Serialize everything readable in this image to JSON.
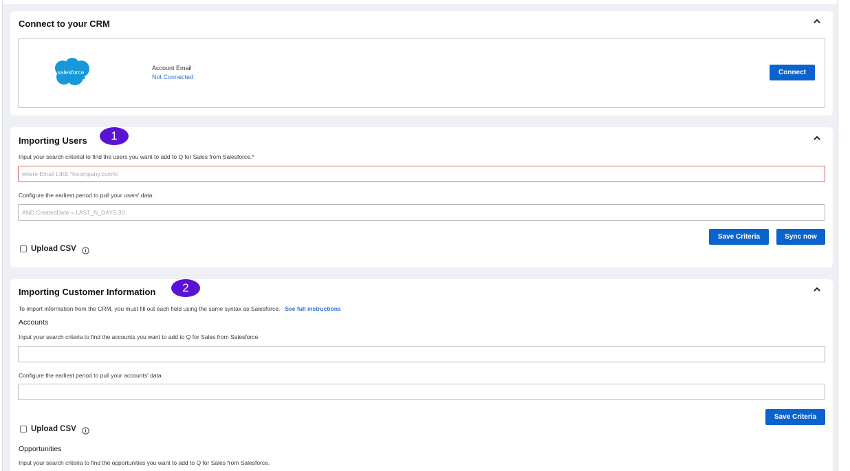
{
  "crm": {
    "title": "Connect to your CRM",
    "logo_text": "salesforce",
    "account_label": "Account Email",
    "account_status": "Not Connected",
    "connect_label": "Connect"
  },
  "users": {
    "title": "Importing Users",
    "badge": "1",
    "search_hint": "Input your search criterial to find the users you want to add to Q for Sales from Salesforce.*",
    "search_placeholder": "where Email LIKE '%company.com%'",
    "period_hint": "Configure the earliest period to pull your users' data.",
    "period_placeholder": "AND CreatedDate = LAST_N_DAYS:30",
    "save_label": "Save Criteria",
    "sync_label": "Sync now",
    "upload_label": "Upload CSV"
  },
  "customer": {
    "title": "Importing Customer Information",
    "badge": "2",
    "instructions": "To import information from the CRM, you must fill out each field using the same syntax as Salesforce.",
    "instructions_link": "See full instructions",
    "accounts_heading": "Accounts",
    "accounts_hint": "Input your search criteria to find the accounts you want to add to Q for Sales from Salesforce.",
    "accounts_period_hint": "Configure the earliest period to pull your accounts' data",
    "save_label": "Save Criteria",
    "upload_label": "Upload CSV",
    "opportunities_heading": "Opportunities",
    "opportunities_hint": "Input your search criteria to find the opportunities you want to add to Q for Sales from Salesforce."
  },
  "colors": {
    "primary_button": "#0b63ce",
    "badge": "#5b13d3",
    "link": "#2f6fd1",
    "error_border": "#e05a5a",
    "salesforce_blue": "#1798d9"
  },
  "icons": [
    "chevron-up-icon",
    "info-icon",
    "salesforce-logo"
  ]
}
